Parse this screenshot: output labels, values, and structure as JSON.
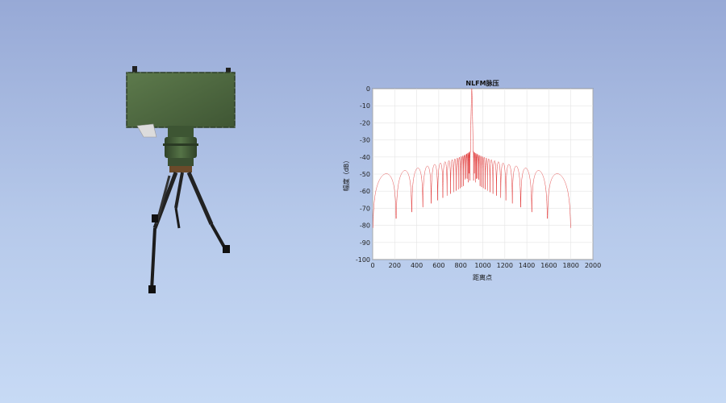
{
  "chart_data": {
    "type": "line",
    "title": "NLFM脉压",
    "xlabel": "距离点",
    "ylabel": "幅度（dB）",
    "xlim": [
      0,
      2000
    ],
    "ylim": [
      -100,
      0
    ],
    "xticks": [
      0,
      200,
      400,
      600,
      800,
      1000,
      1200,
      1400,
      1600,
      1800,
      2000
    ],
    "yticks": [
      0,
      -10,
      -20,
      -30,
      -40,
      -50,
      -60,
      -70,
      -80,
      -90,
      -100
    ],
    "grid": true,
    "series": [
      {
        "color": "#e03030",
        "peak_x": 900,
        "peak_y": 0,
        "x_start": 0,
        "x_end": 1800,
        "sidelobe_edge_level": -51,
        "sidelobe_near_peak_level": -35,
        "null_floor": -90
      }
    ]
  },
  "colors": {
    "background_top": "#97a9d6",
    "background_bottom": "#c7daf5",
    "radar_body": "#4f6b41",
    "plot_line": "#e03030"
  }
}
